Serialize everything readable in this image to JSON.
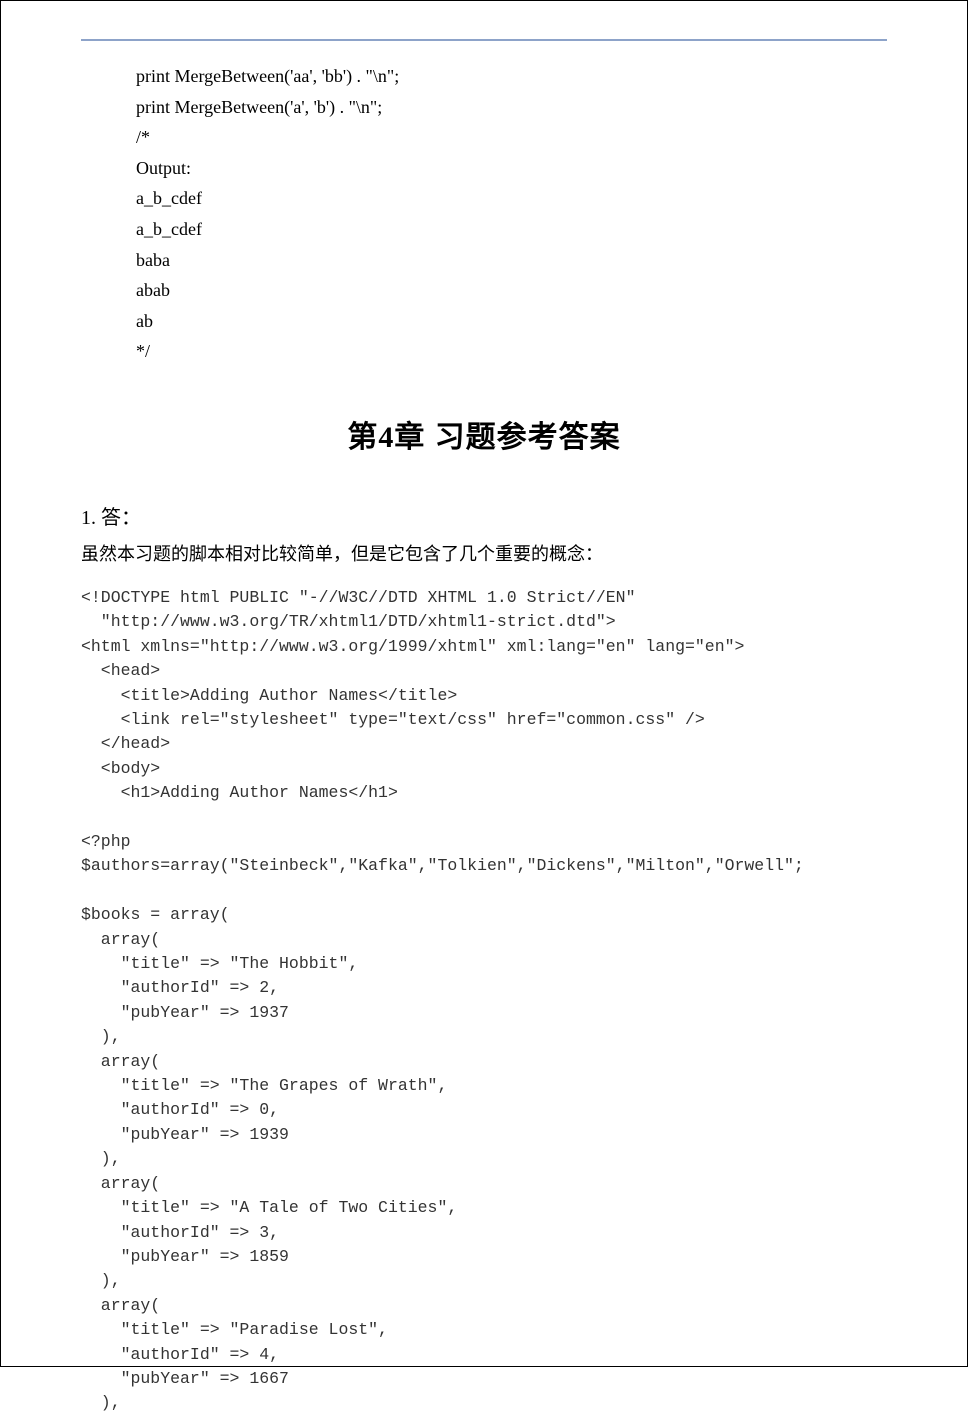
{
  "first_block": {
    "lines": [
      "print MergeBetween('aa', 'bb') . \"\\n\";",
      "print MergeBetween('a', 'b') . \"\\n\";",
      "/*",
      "Output:",
      "a_b_cdef",
      "a_b_cdef",
      "baba",
      "abab",
      "ab",
      "*/"
    ]
  },
  "chapter": {
    "prefix": "第",
    "number": "4",
    "suffix": "章",
    "spacer": "    ",
    "title": "习题参考答案"
  },
  "answer_label": "1. 答：",
  "description": "虽然本习题的脚本相对比较简单，但是它包含了几个重要的概念：",
  "code_lines": [
    "<!DOCTYPE html PUBLIC \"-//W3C//DTD XHTML 1.0 Strict//EN\"",
    "  \"http://www.w3.org/TR/xhtml1/DTD/xhtml1-strict.dtd\">",
    "<html xmlns=\"http://www.w3.org/1999/xhtml\" xml:lang=\"en\" lang=\"en\">",
    "  <head>",
    "    <title>Adding Author Names</title>",
    "    <link rel=\"stylesheet\" type=\"text/css\" href=\"common.css\" />",
    "  </head>",
    "  <body>",
    "    <h1>Adding Author Names</h1>",
    "",
    "<?php",
    "$authors=array(\"Steinbeck\",\"Kafka\",\"Tolkien\",\"Dickens\",\"Milton\",\"Orwell\";",
    "",
    "$books = array(",
    "  array(",
    "    \"title\" => \"The Hobbit\",",
    "    \"authorId\" => 2,",
    "    \"pubYear\" => 1937",
    "  ),",
    "  array(",
    "    \"title\" => \"The Grapes of Wrath\",",
    "    \"authorId\" => 0,",
    "    \"pubYear\" => 1939",
    "  ),",
    "  array(",
    "    \"title\" => \"A Tale of Two Cities\",",
    "    \"authorId\" => 3,",
    "    \"pubYear\" => 1859",
    "  ),",
    "  array(",
    "    \"title\" => \"Paradise Lost\",",
    "    \"authorId\" => 4,",
    "    \"pubYear\" => 1667",
    "  ),"
  ]
}
